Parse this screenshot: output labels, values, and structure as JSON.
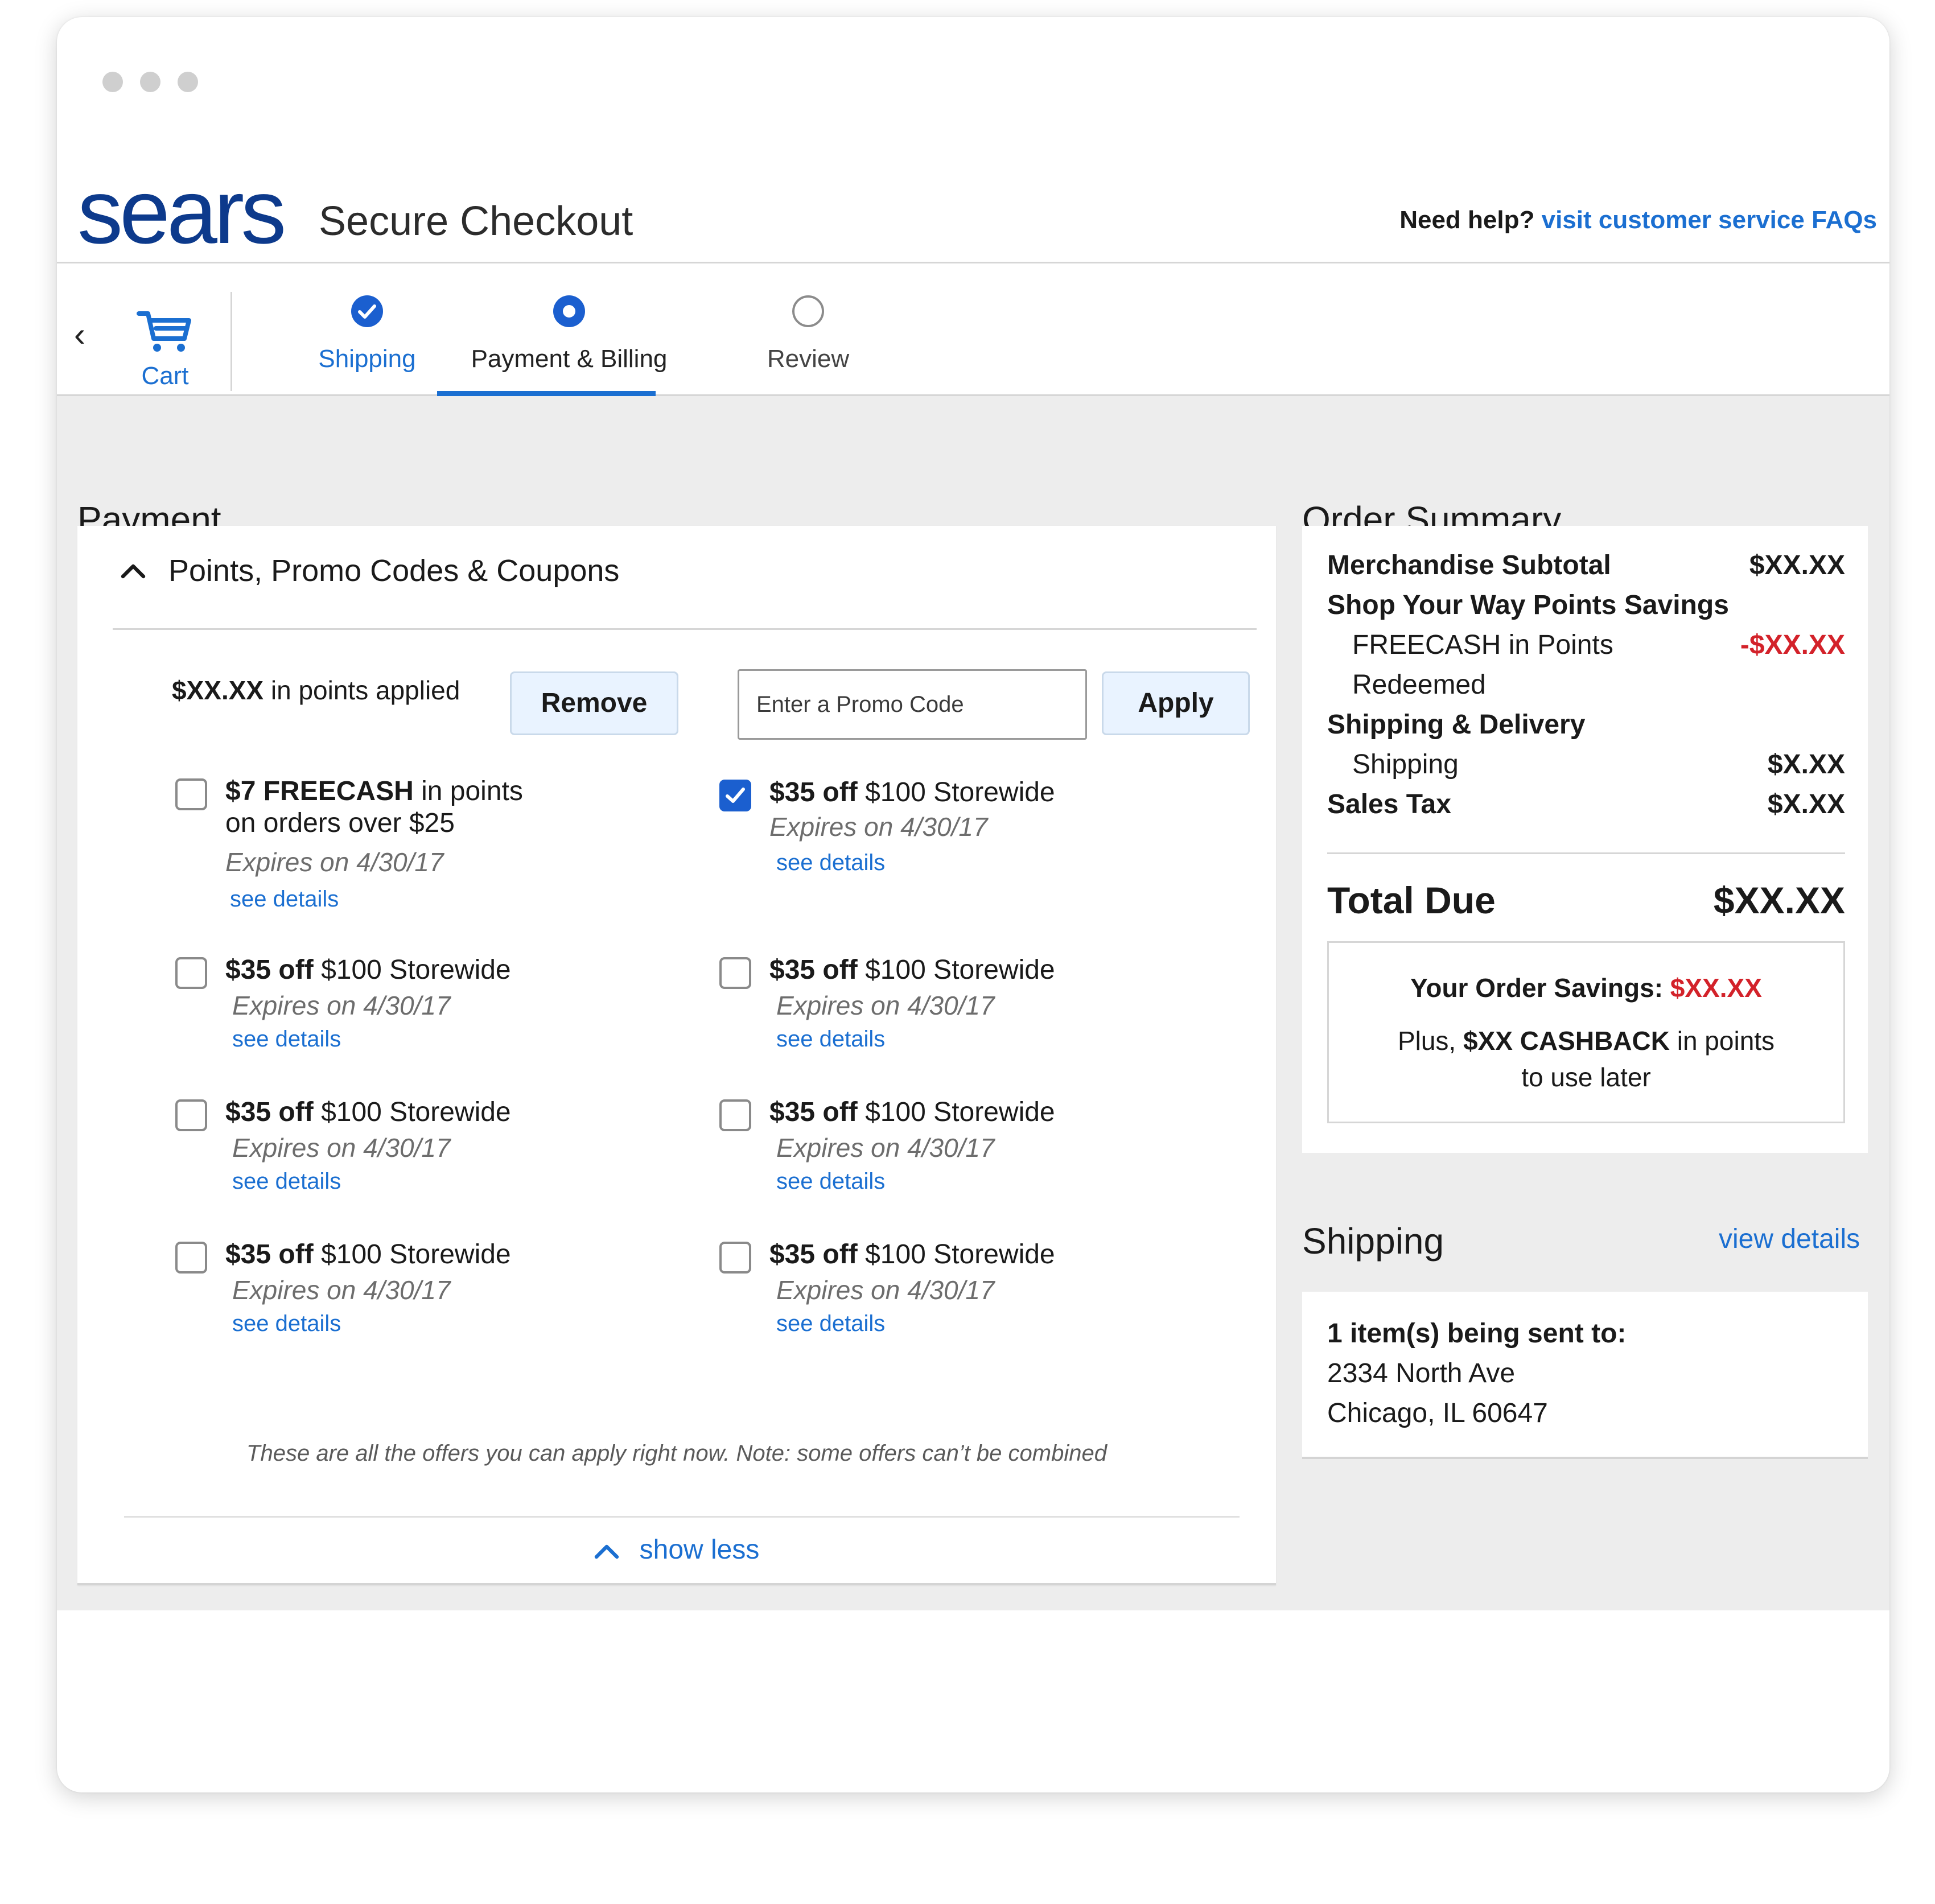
{
  "header": {
    "logo_text": "sears",
    "title": "Secure Checkout",
    "help_prefix": "Need help?",
    "help_link": "visit customer service FAQs"
  },
  "stepper": {
    "cart_label": "Cart",
    "steps": [
      {
        "label": "Shipping",
        "state": "completed"
      },
      {
        "label": "Payment & Billing",
        "state": "active"
      },
      {
        "label": "Review",
        "state": "pending"
      }
    ]
  },
  "payment": {
    "title": "Payment",
    "accordion_title": "Points, Promo Codes & Coupons",
    "points_amount": "$XX.XX",
    "points_suffix": "in points applied",
    "remove_label": "Remove",
    "promo_placeholder": "Enter a Promo Code",
    "apply_label": "Apply",
    "offers": [
      {
        "bold": "$7 FREECASH",
        "rest": "in points",
        "line2": "on orders over $25",
        "expires": "Expires on 4/30/17",
        "link": "see details",
        "checked": false
      },
      {
        "bold": "$35 off",
        "rest": "$100 Storewide",
        "line2": "",
        "expires": "Expires on 4/30/17",
        "link": "see details",
        "checked": true
      },
      {
        "bold": "$35 off",
        "rest": "$100 Storewide",
        "line2": "",
        "expires": "Expires on 4/30/17",
        "link": "see details",
        "checked": false
      },
      {
        "bold": "$35 off",
        "rest": "$100 Storewide",
        "line2": "",
        "expires": "Expires on 4/30/17",
        "link": "see details",
        "checked": false
      },
      {
        "bold": "$35 off",
        "rest": "$100 Storewide",
        "line2": "",
        "expires": "Expires on 4/30/17",
        "link": "see details",
        "checked": false
      },
      {
        "bold": "$35 off",
        "rest": "$100 Storewide",
        "line2": "",
        "expires": "Expires on 4/30/17",
        "link": "see details",
        "checked": false
      },
      {
        "bold": "$35 off",
        "rest": "$100 Storewide",
        "line2": "",
        "expires": "Expires on 4/30/17",
        "link": "see details",
        "checked": false
      },
      {
        "bold": "$35 off",
        "rest": "$100 Storewide",
        "line2": "",
        "expires": "Expires on 4/30/17",
        "link": "see details",
        "checked": false
      }
    ],
    "note": "These are all the offers you can apply right now. Note: some offers can’t be combined",
    "show_less": "show less"
  },
  "order_summary": {
    "title": "Order Summary",
    "merch_label": "Merchandise Subtotal",
    "merch_value": "$XX.XX",
    "syw_label": "Shop Your Way Points Savings",
    "freecash_label_1": "FREECASH in Points",
    "freecash_label_2": "Redeemed",
    "freecash_value": "-$XX.XX",
    "ship_delivery_label": "Shipping & Delivery",
    "shipping_label": "Shipping",
    "shipping_value": "$X.XX",
    "tax_label": "Sales Tax",
    "tax_value": "$X.XX",
    "total_label": "Total Due",
    "total_value": "$XX.XX",
    "savings_label": "Your Order Savings:",
    "savings_value": "$XX.XX",
    "cashback_prefix": "Plus,",
    "cashback_bold": "$XX CASHBACK",
    "cashback_suffix": "in points",
    "cashback_line2": "to use later"
  },
  "shipping_summary": {
    "title": "Shipping",
    "view_details": "view details",
    "items_label": "1 item(s) being sent to:",
    "address_line1": "2334 North Ave",
    "address_line2": "Chicago, IL 60647"
  },
  "colors": {
    "brand_blue": "#0d3a8c",
    "link_blue": "#1b6fd1",
    "discount_red": "#d3222a",
    "button_bg": "#e9f3ff",
    "page_grey": "#ededed"
  }
}
